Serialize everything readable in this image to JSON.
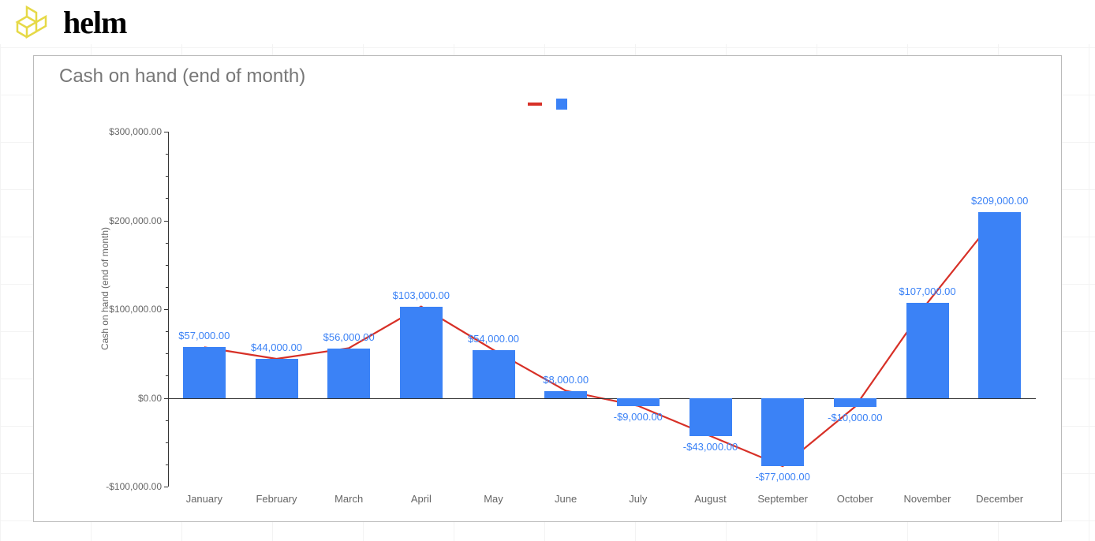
{
  "brand": {
    "name": "helm"
  },
  "chart_data": {
    "type": "bar",
    "title": "Cash on hand (end of month)",
    "ylabel": "Cash on hand (end of month)",
    "xlabel": "",
    "ylim": [
      -100000,
      300000
    ],
    "categories": [
      "January",
      "February",
      "March",
      "April",
      "May",
      "June",
      "July",
      "August",
      "September",
      "October",
      "November",
      "December"
    ],
    "series": [
      {
        "name": "",
        "type": "bar",
        "color": "#3b82f6",
        "values": [
          57000,
          44000,
          56000,
          103000,
          54000,
          8000,
          -9000,
          -43000,
          -77000,
          -10000,
          107000,
          209000
        ],
        "value_labels": [
          "$57,000.00",
          "$44,000.00",
          "$56,000.00",
          "$103,000.00",
          "$54,000.00",
          "$8,000.00",
          "-$9,000.00",
          "-$43,000.00",
          "-$77,000.00",
          "-$10,000.00",
          "$107,000.00",
          "$209,000.00"
        ]
      },
      {
        "name": "",
        "type": "line",
        "color": "#d73027",
        "values": [
          57000,
          44000,
          56000,
          103000,
          54000,
          8000,
          -9000,
          -43000,
          -77000,
          -10000,
          107000,
          209000
        ]
      }
    ],
    "yticks": [
      -100000,
      0,
      100000,
      200000,
      300000
    ],
    "ytick_labels": [
      "-$100,000.00",
      "$0.00",
      "$100,000.00",
      "$200,000.00",
      "$300,000.00"
    ]
  }
}
